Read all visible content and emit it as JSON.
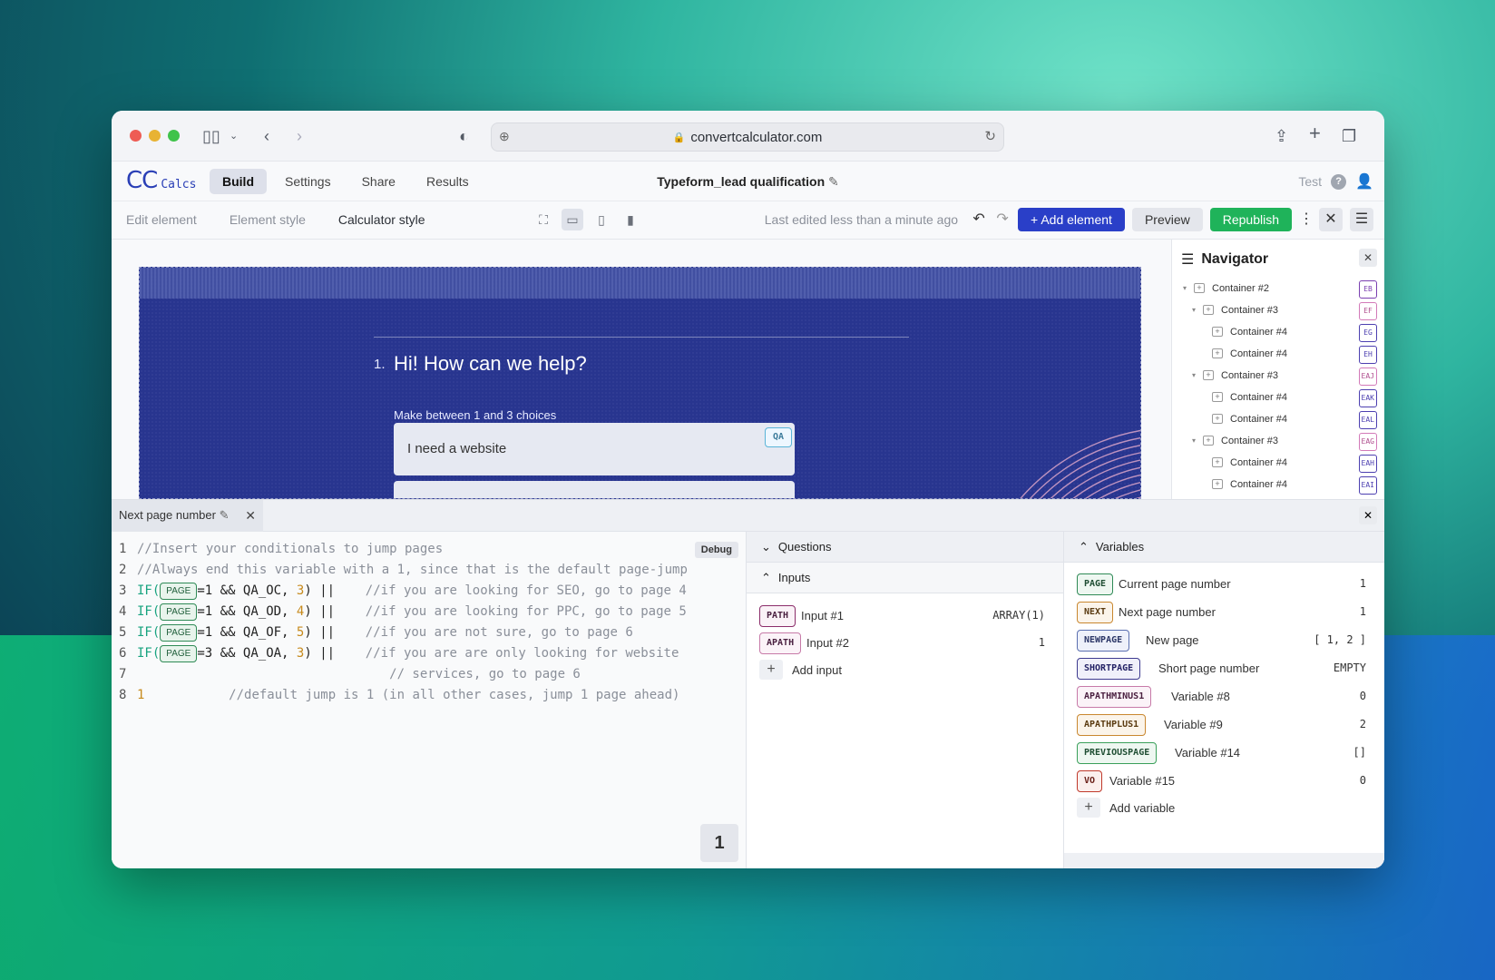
{
  "browser": {
    "url": "convertcalculator.com"
  },
  "app": {
    "logo_main": "CC",
    "logo_sub": "Calcs",
    "nav_tabs": [
      {
        "label": "Build"
      },
      {
        "label": "Settings"
      },
      {
        "label": "Share"
      },
      {
        "label": "Results"
      }
    ],
    "doc_title": "Typeform_lead qualification",
    "test_label": "Test"
  },
  "toolbar": {
    "subtabs": [
      "Edit element",
      "Element style",
      "Calculator style"
    ],
    "last_edited": "Last edited less than a minute ago",
    "add_element": "+ Add element",
    "preview": "Preview",
    "republish": "Republish"
  },
  "preview": {
    "question_number": "1.",
    "question_title": "Hi! How can we help?",
    "hint": "Make between 1 and 3 choices",
    "choices": [
      {
        "label": "I need a website",
        "badge": "QA"
      }
    ]
  },
  "navigator": {
    "title": "Navigator",
    "items": [
      {
        "name": "Container #2",
        "tag": "EB",
        "color": "#7a3fb0"
      },
      {
        "name": "Container #3",
        "tag": "EF",
        "color": "#d27ab8"
      },
      {
        "name": "Container #4",
        "tag": "EG",
        "color": "#4c3fb0"
      },
      {
        "name": "Container #4",
        "tag": "EH",
        "color": "#4c3fb0"
      },
      {
        "name": "Container #3",
        "tag": "EAJ",
        "color": "#d27ab8"
      },
      {
        "name": "Container #4",
        "tag": "EAK",
        "color": "#4c3fb0"
      },
      {
        "name": "Container #4",
        "tag": "EAL",
        "color": "#4c3fb0"
      },
      {
        "name": "Container #3",
        "tag": "EAG",
        "color": "#d27ab8"
      },
      {
        "name": "Container #4",
        "tag": "EAH",
        "color": "#4c3fb0"
      },
      {
        "name": "Container #4",
        "tag": "EAI",
        "color": "#4c3fb0"
      }
    ]
  },
  "bottom_panel": {
    "tab_label": "Next page number",
    "debug_label": "Debug",
    "result": "1",
    "code": [
      {
        "n": "1",
        "text": "//Insert your conditionals to jump pages"
      },
      {
        "n": "2",
        "text": "//Always end this variable with a 1, since that is the default page-jump"
      },
      {
        "n": "3",
        "code": "=1 && QA_OC, ",
        "num": "3",
        "tail": ") ||    ",
        "comment": "//if you are looking for SEO, go to page 4"
      },
      {
        "n": "4",
        "code": "=1 && QA_OD, ",
        "num": "4",
        "tail": ") ||    ",
        "comment": "//if you are looking for PPC, go to page 5"
      },
      {
        "n": "5",
        "code": "=1 && QA_OF, ",
        "num": "5",
        "tail": ") ||    ",
        "comment": "//if you are not sure, go to page 6"
      },
      {
        "n": "6",
        "code": "=3 && QA_OA, ",
        "num": "3",
        "tail": ") ||    ",
        "comment": "//if you are are only looking for website"
      },
      {
        "n": "7",
        "text": "                                 // services, go to page 6"
      },
      {
        "n": "8",
        "num": "1",
        "comment": "           //default jump is 1 (in all other cases, jump 1 page ahead)"
      }
    ],
    "if_keyword": "IF(",
    "page_pill": "PAGE",
    "questions_label": "Questions",
    "inputs_label": "Inputs",
    "inputs": [
      {
        "tag": "PATH",
        "name": "Input #1",
        "value": "ARRAY(1)",
        "color": "#8b2d6a"
      },
      {
        "tag": "APATH",
        "name": "Input #2",
        "value": "1",
        "color": "#c77aa8"
      }
    ],
    "add_input": "Add input",
    "variables_label": "Variables",
    "variables": [
      {
        "tag": "PAGE",
        "name": "Current page number",
        "value": "1",
        "color": "#2f8a56"
      },
      {
        "tag": "NEXT",
        "name": "Next page number",
        "value": "1",
        "color": "#c9872f"
      },
      {
        "tag": "NEWPAGE",
        "name": "New page",
        "value": "[ 1, 2 ]",
        "color": "#5a6fb0"
      },
      {
        "tag": "SHORTPAGE",
        "name": "Short page number",
        "value": "EMPTY",
        "color": "#3d3a8f"
      },
      {
        "tag": "APATHMINUS1",
        "name": "Variable #8",
        "value": "0",
        "color": "#c77aa8"
      },
      {
        "tag": "APATHPLUS1",
        "name": "Variable #9",
        "value": "2",
        "color": "#c9872f"
      },
      {
        "tag": "PREVIOUSPAGE",
        "name": "Variable #14",
        "value": "[]",
        "color": "#3aa05a"
      },
      {
        "tag": "VO",
        "name": "Variable #15",
        "value": "0",
        "color": "#c0392b"
      }
    ],
    "add_variable": "Add variable"
  }
}
